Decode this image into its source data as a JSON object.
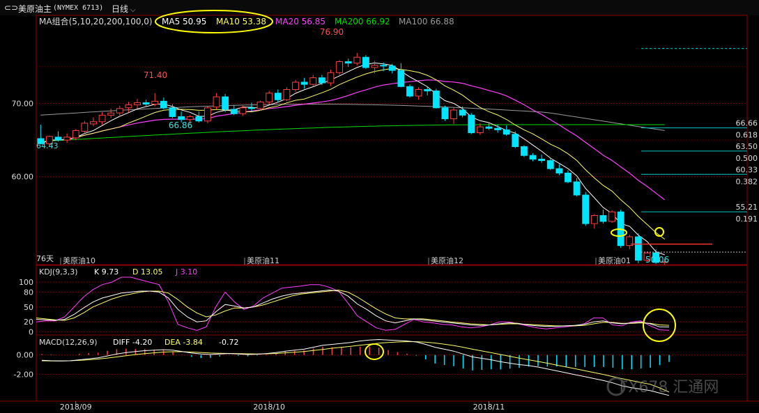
{
  "header": {
    "back_icon": "back-forward-icon",
    "title": "美原油主",
    "code": "(NYMEX 6713)",
    "period": "日线"
  },
  "colors": {
    "up": "#ff4040",
    "down": "#00e5ff",
    "ma5": "#ffffff",
    "ma10": "#ffff66",
    "ma20": "#ff40ff",
    "ma200": "#00dd00",
    "ma100": "#9a9a9a",
    "grid": "#7a0000",
    "fib": "#00c8c8",
    "highlight": "#ffff00"
  },
  "main_legend": {
    "group": "MA组合(5,10,20,200,100,0)",
    "ma5": "MA5 50.95",
    "ma10": "MA10 53.38",
    "ma20": "MA20 56.85",
    "ma200": "MA200 66.92",
    "ma100": "MA100 66.88"
  },
  "kdj_legend": {
    "name": "KDJ(9,3,3)",
    "k": "K 9.73",
    "d": "D 13.05",
    "j": "J 3.10"
  },
  "macd_legend": {
    "name": "MACD(12,26,9)",
    "diff": "DIFF -4.20",
    "dea": "DEA -3.84",
    "macd": "-0.72"
  },
  "chart_data": [
    {
      "type": "candlestick",
      "panel": "price",
      "y_ticks": [
        "70.00",
        "60.00"
      ],
      "y_tick_values": [
        70,
        60
      ],
      "ylim": [
        48.0,
        80.5
      ],
      "candles": [
        [
          65.2,
          67.1,
          64.4,
          64.5
        ],
        [
          64.5,
          65.6,
          64.2,
          65.5
        ],
        [
          65.4,
          66.2,
          64.8,
          65.0
        ],
        [
          65.0,
          65.9,
          64.6,
          65.4
        ],
        [
          65.3,
          66.5,
          65.0,
          66.3
        ],
        [
          66.2,
          67.6,
          65.9,
          67.3
        ],
        [
          67.2,
          68.1,
          66.9,
          67.5
        ],
        [
          67.5,
          68.8,
          67.1,
          68.4
        ],
        [
          68.4,
          69.3,
          68.0,
          68.7
        ],
        [
          68.7,
          69.7,
          68.1,
          69.3
        ],
        [
          69.4,
          70.2,
          68.8,
          69.8
        ],
        [
          69.8,
          70.6,
          69.3,
          70.1
        ],
        [
          70.1,
          70.5,
          69.5,
          69.9
        ],
        [
          69.9,
          71.4,
          69.6,
          70.3
        ],
        [
          70.3,
          70.8,
          69.2,
          69.4
        ],
        [
          69.4,
          69.9,
          68.0,
          68.2
        ],
        [
          68.2,
          68.9,
          67.4,
          67.8
        ],
        [
          67.8,
          68.4,
          67.1,
          68.2
        ],
        [
          68.2,
          68.9,
          67.4,
          67.6
        ],
        [
          67.6,
          69.6,
          67.3,
          69.4
        ],
        [
          69.5,
          71.4,
          69.2,
          70.9
        ],
        [
          70.9,
          71.3,
          68.8,
          69.2
        ],
        [
          69.2,
          69.8,
          68.4,
          68.6
        ],
        [
          68.6,
          69.7,
          68.3,
          69.4
        ],
        [
          69.4,
          70.1,
          68.9,
          69.3
        ],
        [
          69.3,
          70.4,
          69.0,
          70.2
        ],
        [
          70.2,
          71.7,
          69.9,
          71.4
        ],
        [
          71.4,
          71.9,
          70.2,
          70.5
        ],
        [
          70.5,
          72.2,
          70.3,
          71.9
        ],
        [
          71.9,
          73.2,
          71.6,
          72.9
        ],
        [
          72.9,
          73.5,
          72.0,
          72.6
        ],
        [
          72.6,
          73.9,
          72.3,
          73.5
        ],
        [
          73.5,
          73.9,
          72.5,
          72.8
        ],
        [
          72.8,
          74.6,
          72.4,
          74.2
        ],
        [
          74.2,
          75.9,
          73.9,
          75.7
        ],
        [
          75.7,
          76.1,
          75.0,
          75.5
        ],
        [
          75.5,
          76.9,
          75.2,
          76.3
        ],
        [
          76.3,
          76.6,
          74.7,
          74.9
        ],
        [
          74.9,
          75.8,
          74.1,
          75.2
        ],
        [
          75.2,
          75.6,
          74.4,
          75.1
        ],
        [
          75.1,
          75.4,
          74.1,
          74.5
        ],
        [
          74.5,
          75.5,
          72.2,
          72.3
        ],
        [
          72.3,
          72.6,
          70.8,
          71.0
        ],
        [
          71.0,
          72.2,
          70.5,
          71.9
        ],
        [
          71.9,
          72.3,
          71.1,
          71.7
        ],
        [
          71.7,
          72.0,
          69.3,
          69.4
        ],
        [
          69.4,
          69.7,
          67.6,
          67.9
        ],
        [
          67.9,
          69.4,
          67.2,
          69.1
        ],
        [
          69.1,
          69.6,
          68.1,
          68.4
        ],
        [
          68.4,
          68.7,
          65.8,
          66.0
        ],
        [
          66.0,
          67.3,
          65.7,
          66.8
        ],
        [
          66.8,
          67.3,
          66.4,
          66.6
        ],
        [
          66.6,
          67.1,
          66.0,
          66.4
        ],
        [
          66.4,
          67.0,
          65.6,
          65.8
        ],
        [
          65.8,
          66.2,
          63.9,
          64.1
        ],
        [
          64.1,
          64.3,
          62.7,
          62.9
        ],
        [
          62.9,
          63.2,
          62.1,
          62.4
        ],
        [
          62.4,
          63.0,
          61.9,
          62.2
        ],
        [
          62.2,
          62.5,
          60.9,
          61.1
        ],
        [
          61.1,
          61.7,
          60.2,
          60.5
        ],
        [
          60.5,
          60.9,
          59.1,
          59.3
        ],
        [
          59.3,
          59.8,
          57.3,
          57.5
        ],
        [
          57.5,
          57.9,
          53.3,
          53.6
        ],
        [
          53.6,
          54.9,
          52.9,
          54.7
        ],
        [
          54.7,
          55.5,
          53.6,
          53.9
        ],
        [
          53.9,
          55.4,
          53.7,
          55.2
        ],
        [
          55.2,
          55.5,
          50.3,
          50.6
        ],
        [
          50.6,
          52.1,
          50.1,
          51.8
        ],
        [
          51.8,
          52.3,
          48.2,
          48.6
        ],
        [
          48.6,
          49.8,
          48.4,
          49.6
        ],
        [
          49.6,
          50.1,
          48.1,
          48.3
        ],
        [
          48.3,
          48.7,
          48.0,
          48.4
        ]
      ],
      "annotations": {
        "high1": "71.40",
        "high2": "76.90",
        "low1": "66.86",
        "left_low": "64.43",
        "last": "50.06",
        "days": "76天"
      },
      "fib_levels": [
        {
          "price": "66.66",
          "ratio": "0.618",
          "value": 66.66
        },
        {
          "price": "63.50",
          "ratio": "0.500",
          "value": 63.5
        },
        {
          "price": "60.33",
          "ratio": "0.382",
          "value": 60.33
        },
        {
          "price": "55.21",
          "ratio": "0.191",
          "value": 55.21
        }
      ],
      "top_ref_line": 77.5,
      "red_level": 50.8,
      "contract_labels": [
        "美原油10",
        "美原油11",
        "美原油12",
        "美原油01"
      ]
    },
    {
      "type": "line",
      "panel": "kdj",
      "y_ticks": [
        "100",
        "80",
        "50",
        "20",
        "0"
      ],
      "y_tick_values": [
        100,
        80,
        50,
        20,
        0
      ],
      "ylim": [
        -5,
        110
      ],
      "k": [
        25,
        24,
        23,
        25,
        35,
        48,
        60,
        68,
        73,
        78,
        80,
        82,
        82,
        80,
        68,
        45,
        30,
        20,
        22,
        40,
        55,
        52,
        48,
        50,
        58,
        66,
        72,
        76,
        78,
        80,
        82,
        84,
        82,
        72,
        56,
        45,
        32,
        22,
        18,
        22,
        26,
        24,
        22,
        20,
        18,
        16,
        14,
        13,
        14,
        16,
        18,
        17,
        14,
        12,
        11,
        11,
        12,
        13,
        15,
        20,
        22,
        18,
        16,
        18,
        20,
        16,
        10,
        9.7
      ],
      "d": [
        28,
        26,
        24,
        23,
        28,
        38,
        50,
        58,
        66,
        72,
        76,
        80,
        82,
        82,
        78,
        65,
        50,
        38,
        30,
        34,
        42,
        48,
        48,
        50,
        54,
        60,
        66,
        72,
        76,
        78,
        80,
        82,
        84,
        80,
        70,
        58,
        46,
        36,
        28,
        26,
        26,
        26,
        24,
        22,
        20,
        18,
        16,
        15,
        14,
        15,
        16,
        16,
        15,
        14,
        13,
        12,
        12,
        12,
        13,
        16,
        19,
        19,
        17,
        17,
        18,
        17,
        14,
        13.05
      ],
      "j": [
        20,
        22,
        22,
        30,
        50,
        70,
        85,
        95,
        100,
        110,
        110,
        105,
        100,
        95,
        60,
        15,
        8,
        3,
        10,
        50,
        80,
        60,
        45,
        52,
        68,
        78,
        88,
        90,
        92,
        95,
        95,
        90,
        82,
        58,
        32,
        20,
        8,
        3,
        5,
        15,
        25,
        20,
        18,
        15,
        14,
        10,
        8,
        10,
        14,
        20,
        20,
        16,
        12,
        8,
        6,
        8,
        10,
        12,
        16,
        28,
        28,
        14,
        12,
        20,
        22,
        12,
        4,
        3.1
      ]
    },
    {
      "type": "bar+line",
      "panel": "macd",
      "y_ticks": [
        "0.00",
        "-2.00"
      ],
      "y_tick_values": [
        0,
        -2
      ],
      "ylim": [
        -4.5,
        2.0
      ],
      "diff": [
        -0.55,
        -0.6,
        -0.62,
        -0.6,
        -0.5,
        -0.4,
        -0.3,
        -0.1,
        0.1,
        0.25,
        0.35,
        0.45,
        0.5,
        0.55,
        0.5,
        0.35,
        0.2,
        0.1,
        0.05,
        0.1,
        0.15,
        0.1,
        0.05,
        0.08,
        0.15,
        0.25,
        0.4,
        0.5,
        0.6,
        0.8,
        1.0,
        1.1,
        1.2,
        1.3,
        1.45,
        1.55,
        1.6,
        1.55,
        1.5,
        1.45,
        1.35,
        1.1,
        0.8,
        0.6,
        0.4,
        0.1,
        -0.2,
        -0.35,
        -0.5,
        -0.7,
        -0.85,
        -1.0,
        -1.1,
        -1.25,
        -1.45,
        -1.65,
        -1.85,
        -2.05,
        -2.25,
        -2.45,
        -2.65,
        -2.9,
        -3.2,
        -3.4,
        -3.55,
        -3.7,
        -3.95,
        -4.2
      ],
      "dea": [
        -0.6,
        -0.62,
        -0.62,
        -0.6,
        -0.56,
        -0.5,
        -0.42,
        -0.32,
        -0.2,
        -0.08,
        0.04,
        0.14,
        0.22,
        0.3,
        0.34,
        0.34,
        0.3,
        0.26,
        0.2,
        0.18,
        0.16,
        0.14,
        0.12,
        0.11,
        0.12,
        0.16,
        0.22,
        0.28,
        0.36,
        0.46,
        0.58,
        0.7,
        0.8,
        0.9,
        1.02,
        1.12,
        1.22,
        1.3,
        1.35,
        1.38,
        1.38,
        1.33,
        1.24,
        1.12,
        0.98,
        0.8,
        0.6,
        0.42,
        0.24,
        0.05,
        -0.14,
        -0.33,
        -0.5,
        -0.67,
        -0.85,
        -1.05,
        -1.24,
        -1.43,
        -1.63,
        -1.83,
        -2.03,
        -2.24,
        -2.46,
        -2.66,
        -2.85,
        -3.04,
        -3.42,
        -3.84
      ],
      "macd": [
        0.1,
        0.05,
        0.0,
        0.0,
        0.12,
        0.2,
        0.24,
        0.44,
        0.6,
        0.66,
        0.62,
        0.62,
        0.56,
        0.5,
        0.32,
        0.02,
        -0.2,
        -0.32,
        -0.3,
        -0.16,
        -0.02,
        -0.08,
        -0.14,
        -0.06,
        0.06,
        0.18,
        0.36,
        0.44,
        0.48,
        0.68,
        0.84,
        0.8,
        0.8,
        0.8,
        0.86,
        0.86,
        0.76,
        0.5,
        0.3,
        0.14,
        -0.06,
        -0.46,
        -0.88,
        -1.04,
        -1.16,
        -1.4,
        -1.6,
        -1.54,
        -1.48,
        -1.5,
        -1.42,
        -1.34,
        -1.2,
        -1.16,
        -1.2,
        -1.2,
        -1.22,
        -1.24,
        -1.24,
        -1.24,
        -1.24,
        -1.32,
        -1.48,
        -1.48,
        -1.4,
        -1.32,
        -1.06,
        -0.72
      ]
    }
  ],
  "x_axis": {
    "date_labels": [
      "2018/09",
      "2018/10",
      "2018/11"
    ],
    "date_label_index": [
      4,
      26,
      51
    ]
  },
  "watermark": "FX678 汇通网"
}
